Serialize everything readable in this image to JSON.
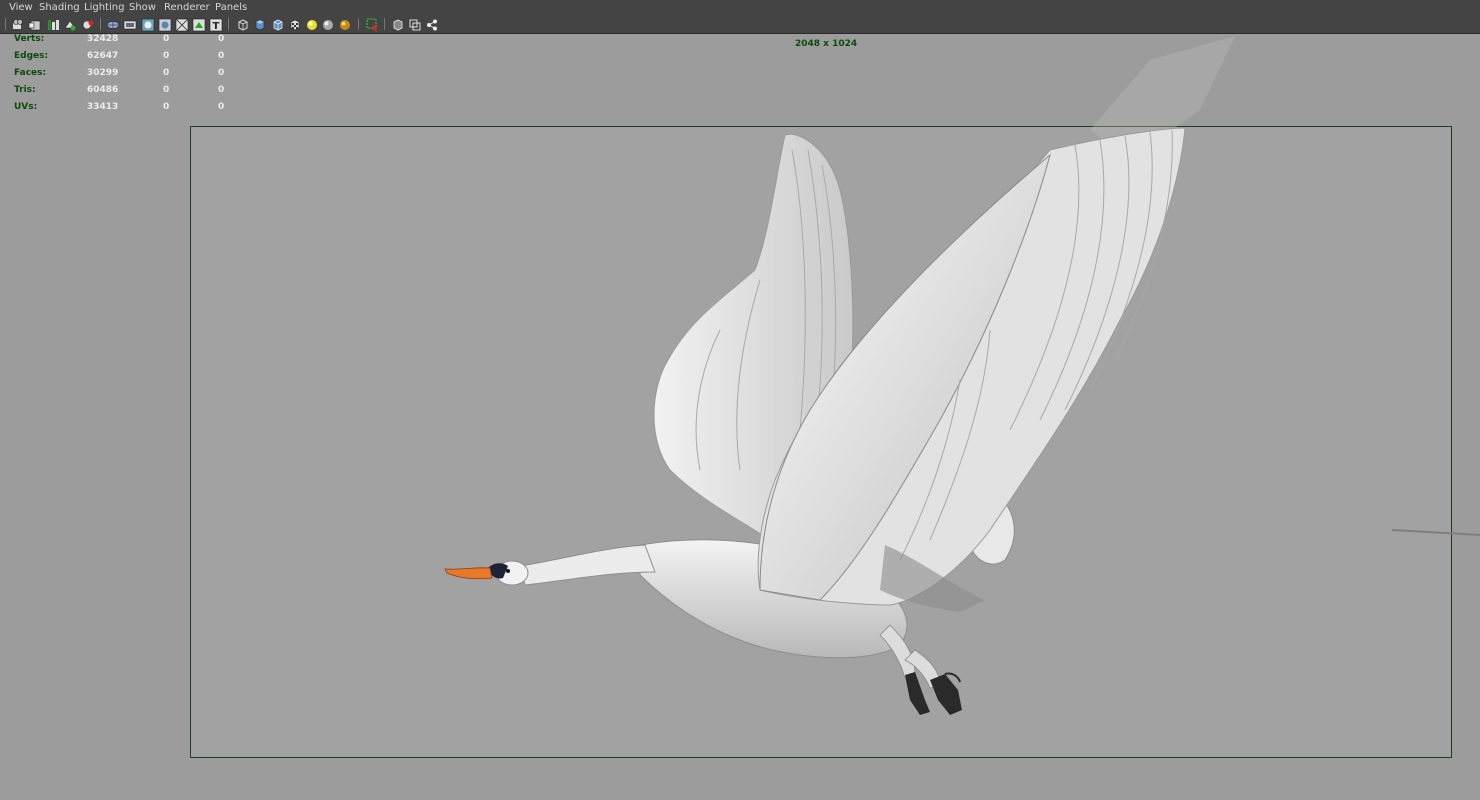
{
  "menu": [
    "View",
    "Shading",
    "Lighting",
    "Show",
    "Renderer",
    "Panels"
  ],
  "hud": {
    "rows": [
      {
        "label": "Verts:",
        "total": "32428",
        "sel1": "0",
        "sel2": "0"
      },
      {
        "label": "Edges:",
        "total": "62647",
        "sel1": "0",
        "sel2": "0"
      },
      {
        "label": "Faces:",
        "total": "30299",
        "sel1": "0",
        "sel2": "0"
      },
      {
        "label": "Tris:",
        "total": "60486",
        "sel1": "0",
        "sel2": "0"
      },
      {
        "label": "UVs:",
        "total": "33413",
        "sel1": "0",
        "sel2": "0"
      }
    ],
    "resolution": "2048 x 1024"
  },
  "toolbar_icons": [
    "camera-select-icon",
    "camera-attributes-icon",
    "bookmarks-icon",
    "image-plane-icon",
    "camera-lock-icon",
    "grid-icon",
    "film-gate-icon",
    "resolution-gate-icon",
    "gate-mask-icon",
    "field-chart-icon",
    "safe-action-icon",
    "safe-title-icon",
    "wireframe-icon",
    "smooth-shade-icon",
    "wireframe-on-shaded-icon",
    "textured-icon",
    "default-light-icon",
    "all-lights-icon",
    "shadows-icon",
    "isolate-select-icon",
    "xray-icon",
    "xray-joints-icon",
    "xray-components-icon"
  ],
  "colors": {
    "hud_label": "#0a4b0a",
    "hud_value": "#ececec",
    "viewport_bg": "#9c9c9c",
    "gate_border": "#15401a",
    "menu_bg": "#444444"
  }
}
